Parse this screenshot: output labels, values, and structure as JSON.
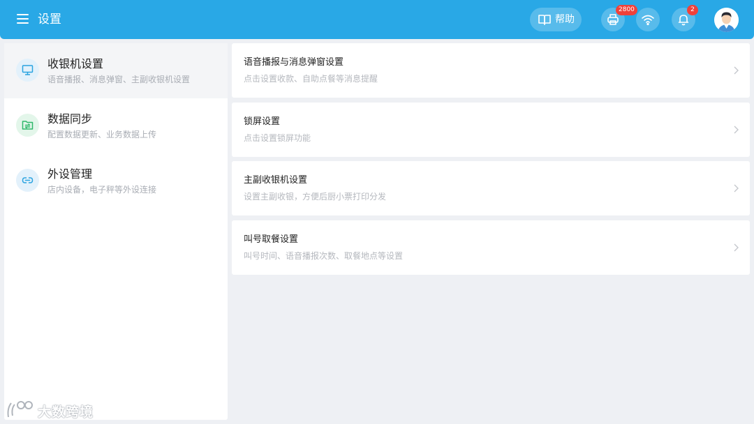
{
  "header": {
    "title": "设置",
    "help_label": "帮助",
    "printer_badge": "2800",
    "notification_badge": "2",
    "accent_color": "#29a8e6"
  },
  "sidebar": {
    "items": [
      {
        "title": "收银机设置",
        "subtitle": "语音播报、消息弹窗、主副收银机设置",
        "icon": "monitor-icon",
        "active": true
      },
      {
        "title": "数据同步",
        "subtitle": "配置数据更新、业务数据上传",
        "icon": "folder-sync-icon",
        "active": false
      },
      {
        "title": "外设管理",
        "subtitle": "店内设备，电子秤等外设连接",
        "icon": "link-icon",
        "active": false
      }
    ]
  },
  "main": {
    "cards": [
      {
        "title": "语音播报与消息弹窗设置",
        "subtitle": "点击设置收款、自助点餐等消息提醒"
      },
      {
        "title": "锁屏设置",
        "subtitle": "点击设置锁屏功能"
      },
      {
        "title": "主副收银机设置",
        "subtitle": "设置主副收银，方便后厨小票打印分发"
      },
      {
        "title": "叫号取餐设置",
        "subtitle": "叫号时间、语音播报次数、取餐地点等设置"
      }
    ]
  },
  "watermark": {
    "text": "大数跨境"
  }
}
